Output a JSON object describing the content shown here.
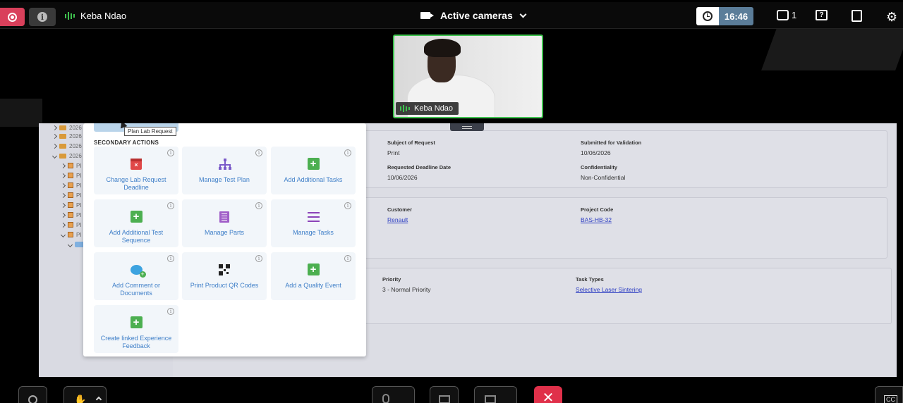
{
  "topbar": {
    "speaker_name": "Keba Ndao",
    "view_title": "Active cameras",
    "timer": "16:46",
    "chat_count": "1",
    "help_glyph": "?"
  },
  "video": {
    "participant_name": "Keba Ndao"
  },
  "shared_screen": {
    "tree_items": [
      "2026",
      "2026",
      "2026",
      "2026",
      "PI",
      "PI",
      "PI",
      "PI",
      "PI",
      "PI",
      "PI",
      "PI"
    ],
    "popup": {
      "tooltip": "Plan Lab Request",
      "section_title": "SECONDARY ACTIONS",
      "info_glyph": "i",
      "actions": [
        {
          "label": "Change Lab Request Deadline",
          "icon": "calendar-delete-icon"
        },
        {
          "label": "Manage Test Plan",
          "icon": "hierarchy-icon"
        },
        {
          "label": "Add Additional Tasks",
          "icon": "plus-icon"
        },
        {
          "label": "Add Additional Test Sequence",
          "icon": "plus-icon"
        },
        {
          "label": "Manage Parts",
          "icon": "list-icon"
        },
        {
          "label": "Manage Tasks",
          "icon": "tasks-icon"
        },
        {
          "label": "Add Comment or Documents",
          "icon": "comment-add-icon"
        },
        {
          "label": "Print Product QR Codes",
          "icon": "qr-code-icon"
        },
        {
          "label": "Add a Quality Event",
          "icon": "plus-icon"
        },
        {
          "label": "Create linked Experience Feedback",
          "icon": "plus-icon"
        }
      ]
    },
    "fields": {
      "subject_label": "Subject of Request",
      "subject_value": "Print",
      "submitted_label": "Submitted for Validation",
      "submitted_value": "10/06/2026",
      "deadline_label": "Requested Deadline Date",
      "deadline_value": "10/06/2026",
      "confidentiality_label": "Confidentiality",
      "confidentiality_value": "Non-Confidential",
      "customer_label": "Customer",
      "customer_value": "Renault",
      "project_label": "Project Code",
      "project_value": "BAS-HB-32",
      "priority_label": "Priority",
      "priority_value": "3 - Normal Priority",
      "task_types_label": "Task Types",
      "task_types_value": "Selective Laser Sintering"
    }
  },
  "bottom_bar": {
    "hangup_glyph": "✕",
    "captions_label": "CC"
  },
  "colors": {
    "record": "#d9405b",
    "speaking": "#3fc24f",
    "timer_bg": "#5b7d99",
    "hangup": "#e0304a",
    "link": "#3f7fc8"
  }
}
